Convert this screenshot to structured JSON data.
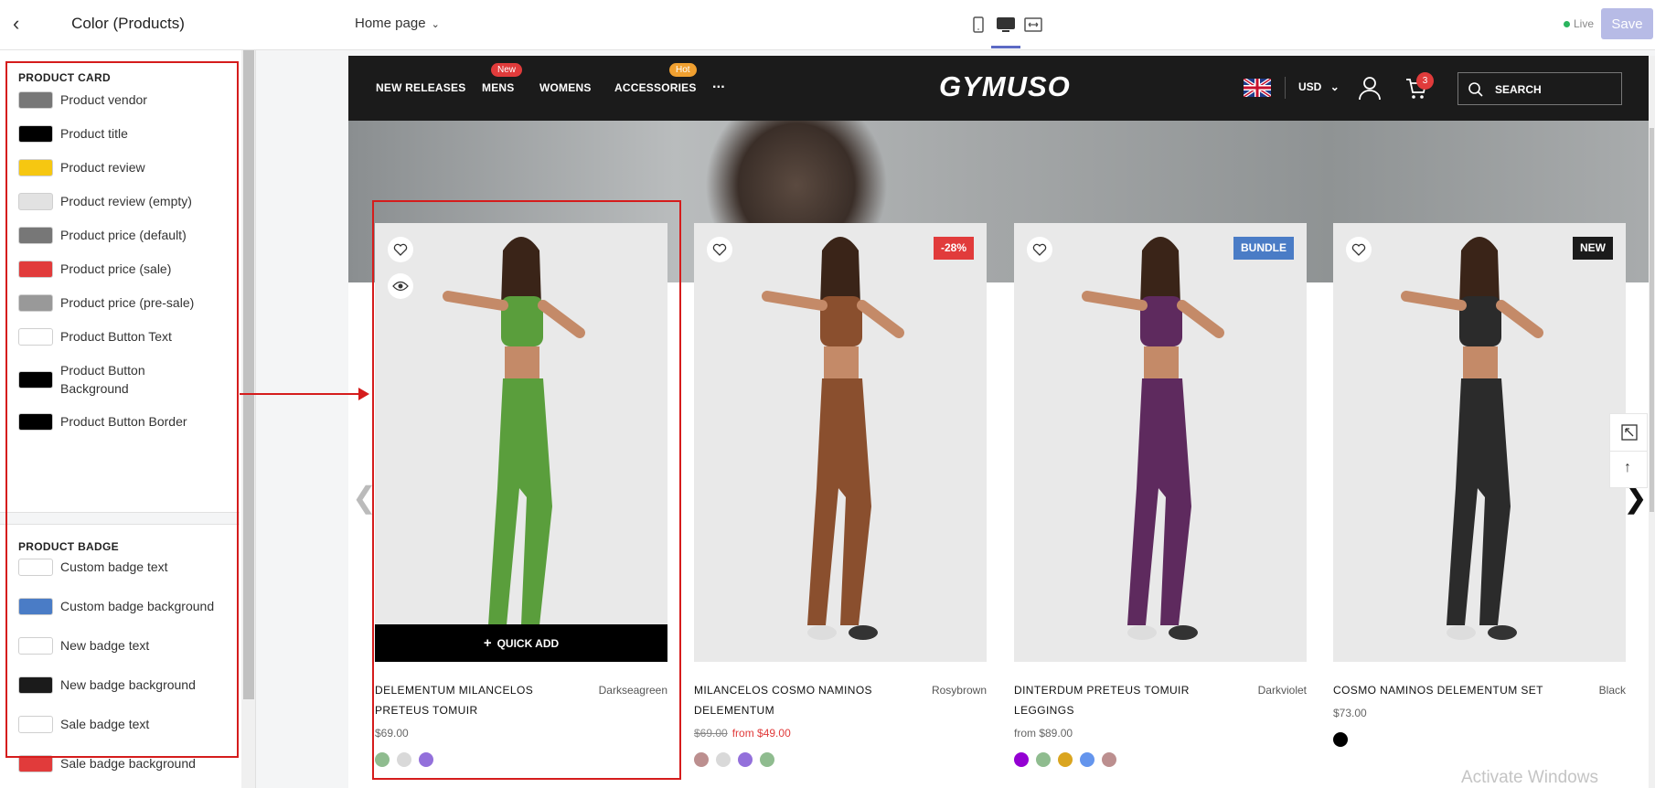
{
  "topbar": {
    "panel_title": "Color (Products)",
    "page_select": "Home page",
    "live_label": "Live",
    "save_label": "Save"
  },
  "sidebar": {
    "product_card": {
      "title": "PRODUCT CARD",
      "items": [
        {
          "label": "Product vendor",
          "color": "#777777"
        },
        {
          "label": "Product title",
          "color": "#000000"
        },
        {
          "label": "Product review",
          "color": "#F6C711"
        },
        {
          "label": "Product review (empty)",
          "color": "#E2E2E2"
        },
        {
          "label": "Product price (default)",
          "color": "#777777"
        },
        {
          "label": "Product price (sale)",
          "color": "#E13B3B"
        },
        {
          "label": "Product price (pre-sale)",
          "color": "#999999"
        },
        {
          "label": "Product Button Text",
          "color": "#FFFFFF"
        },
        {
          "label": "Product Button Background",
          "color": "#000000"
        },
        {
          "label": "Product Button Border",
          "color": "#000000"
        }
      ]
    },
    "product_badge": {
      "title": "PRODUCT BADGE",
      "items": [
        {
          "label": "Custom badge text",
          "color": "#FFFFFF"
        },
        {
          "label": "Custom badge background",
          "color": "#4A7CC6"
        },
        {
          "label": "New badge text",
          "color": "#FFFFFF"
        },
        {
          "label": "New badge background",
          "color": "#1B1B1B"
        },
        {
          "label": "Sale badge text",
          "color": "#FFFFFF"
        },
        {
          "label": "Sale badge background",
          "color": "#E13B3B"
        }
      ]
    }
  },
  "store": {
    "nav": [
      "NEW RELEASES",
      "MENS",
      "WOMENS",
      "ACCESSORIES",
      "..."
    ],
    "nav_badges": {
      "new": "New",
      "hot": "Hot",
      "new_color": "#E13B3B",
      "hot_color": "#F0A030"
    },
    "logo": "GYMUSO",
    "currency": "USD",
    "cart_count": "3",
    "search_label": "SEARCH"
  },
  "products": [
    {
      "title": "DELEMENTUM MILANCELOS PRETEUS TOMUIR",
      "vendor": "Darkseagreen",
      "price": "$69.00",
      "old_price": "",
      "sale_price": "",
      "badge": "",
      "badge_color": "",
      "outfit": "#5a9e3c",
      "swatches": [
        "#8fbc8f",
        "#d9d9d9",
        "#9370db"
      ]
    },
    {
      "title": "MILANCELOS COSMO NAMINOS DELEMENTUM",
      "vendor": "Rosybrown",
      "price": "",
      "old_price": "$69.00",
      "sale_price": "from $49.00",
      "badge": "-28%",
      "badge_color": "#E13B3B",
      "outfit": "#8a4f2e",
      "swatches": [
        "#bc8f8f",
        "#d9d9d9",
        "#9370db",
        "#8fbc8f"
      ]
    },
    {
      "title": "DINTERDUM PRETEUS TOMUIR LEGGINGS",
      "vendor": "Darkviolet",
      "price": "from $89.00",
      "old_price": "",
      "sale_price": "",
      "badge": "BUNDLE",
      "badge_color": "#4A7CC6",
      "outfit": "#5e2a5e",
      "swatches": [
        "#9400d3",
        "#8fbc8f",
        "#daa520",
        "#6495ed",
        "#bc8f8f"
      ]
    },
    {
      "title": "COSMO NAMINOS DELEMENTUM SET",
      "vendor": "Black",
      "price": "$73.00",
      "old_price": "",
      "sale_price": "",
      "badge": "NEW",
      "badge_color": "#1B1B1B",
      "outfit": "#2b2b2b",
      "swatches": [
        "#000000"
      ]
    }
  ],
  "quick_add_label": "QUICK ADD",
  "watermark": "Activate Windows"
}
